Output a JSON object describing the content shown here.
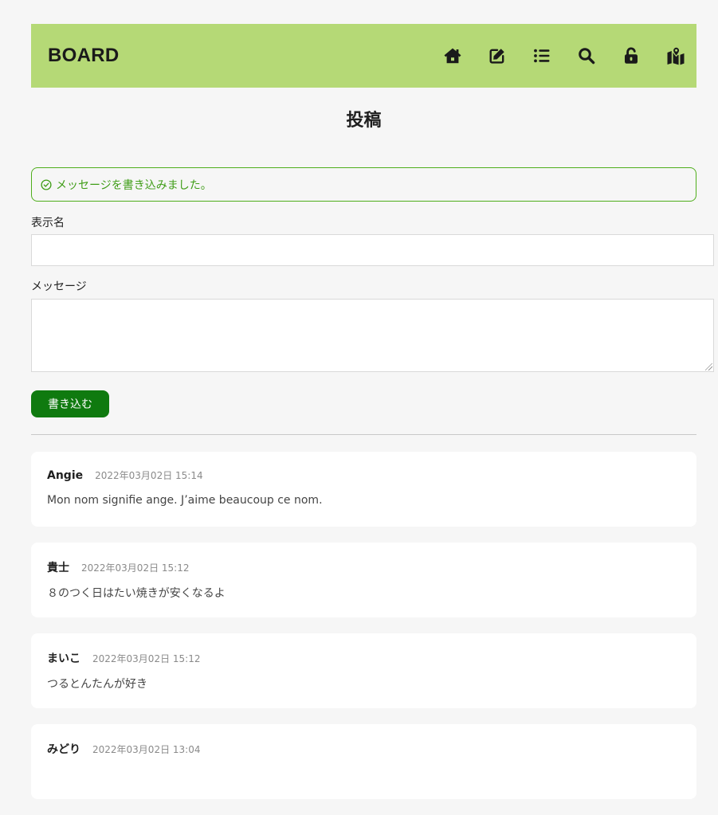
{
  "header": {
    "brand": "BOARD",
    "nav": [
      {
        "icon": "home-icon"
      },
      {
        "icon": "edit-icon"
      },
      {
        "icon": "list-icon"
      },
      {
        "icon": "search-icon"
      },
      {
        "icon": "unlock-icon"
      },
      {
        "icon": "map-icon"
      }
    ],
    "bg_color": "#b5d976"
  },
  "page_title": "投稿",
  "alert": {
    "icon": "check-circle-icon",
    "text": "メッセージを書き込みました。",
    "color": "#3f9d17"
  },
  "form": {
    "name_label": "表示名",
    "name_value": "",
    "message_label": "メッセージ",
    "message_value": "",
    "submit_label": "書き込む",
    "submit_color": "#0f7a0f"
  },
  "posts": [
    {
      "name": "Angie",
      "time": "2022年03月02日 15:14",
      "body": "Mon nom signifie ange. J’aime beaucoup ce nom."
    },
    {
      "name": "貴士",
      "time": "2022年03月02日 15:12",
      "body": "８のつく日はたい焼きが安くなるよ"
    },
    {
      "name": "まいこ",
      "time": "2022年03月02日 15:12",
      "body": "つるとんたんが好き"
    },
    {
      "name": "みどり",
      "time": "2022年03月02日 13:04",
      "body": ""
    }
  ]
}
